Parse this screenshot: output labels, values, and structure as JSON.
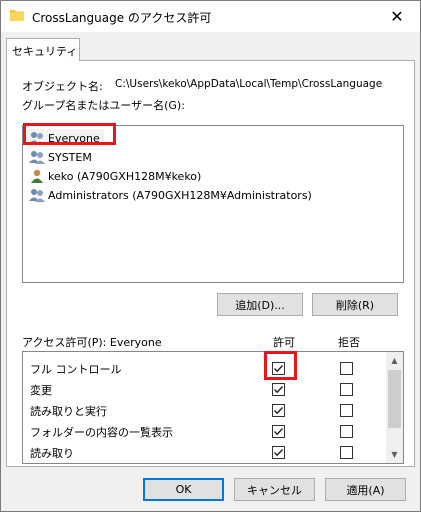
{
  "window": {
    "title": "CrossLanguage のアクセス許可",
    "close_glyph": "✕"
  },
  "tabs": [
    {
      "label": "セキュリティ"
    }
  ],
  "object_name": {
    "label": "オブジェクト名:",
    "value": "C:\\Users\\keko\\AppData\\Local\\Temp\\CrossLanguage"
  },
  "groups_label": "グループ名またはユーザー名(G):",
  "principals": [
    {
      "name": "Everyone",
      "icon": "group-icon",
      "selected": true
    },
    {
      "name": "SYSTEM",
      "icon": "group-icon",
      "selected": false
    },
    {
      "name": "keko (A790GXH128M¥keko)",
      "icon": "user-icon",
      "selected": false
    },
    {
      "name": "Administrators (A790GXH128M¥Administrators)",
      "icon": "group-icon",
      "selected": false
    }
  ],
  "buttons": {
    "add": "追加(D)...",
    "remove": "削除(R)",
    "ok": "OK",
    "cancel": "キャンセル",
    "apply": "適用(A)"
  },
  "permissions_header": {
    "label": "アクセス許可(P): Everyone",
    "allow": "許可",
    "deny": "拒否"
  },
  "permissions": [
    {
      "name": "フル コントロール",
      "allow": true,
      "deny": false
    },
    {
      "name": "変更",
      "allow": true,
      "deny": false
    },
    {
      "name": "読み取りと実行",
      "allow": true,
      "deny": false
    },
    {
      "name": "フォルダーの内容の一覧表示",
      "allow": true,
      "deny": false
    },
    {
      "name": "読み取り",
      "allow": true,
      "deny": false
    }
  ],
  "scrollbar": {
    "up_glyph": "▲",
    "down_glyph": "▼"
  },
  "colors": {
    "highlight": "#e8161b",
    "focus": "#0078d7",
    "dialog_bg": "#f0f0f0"
  }
}
